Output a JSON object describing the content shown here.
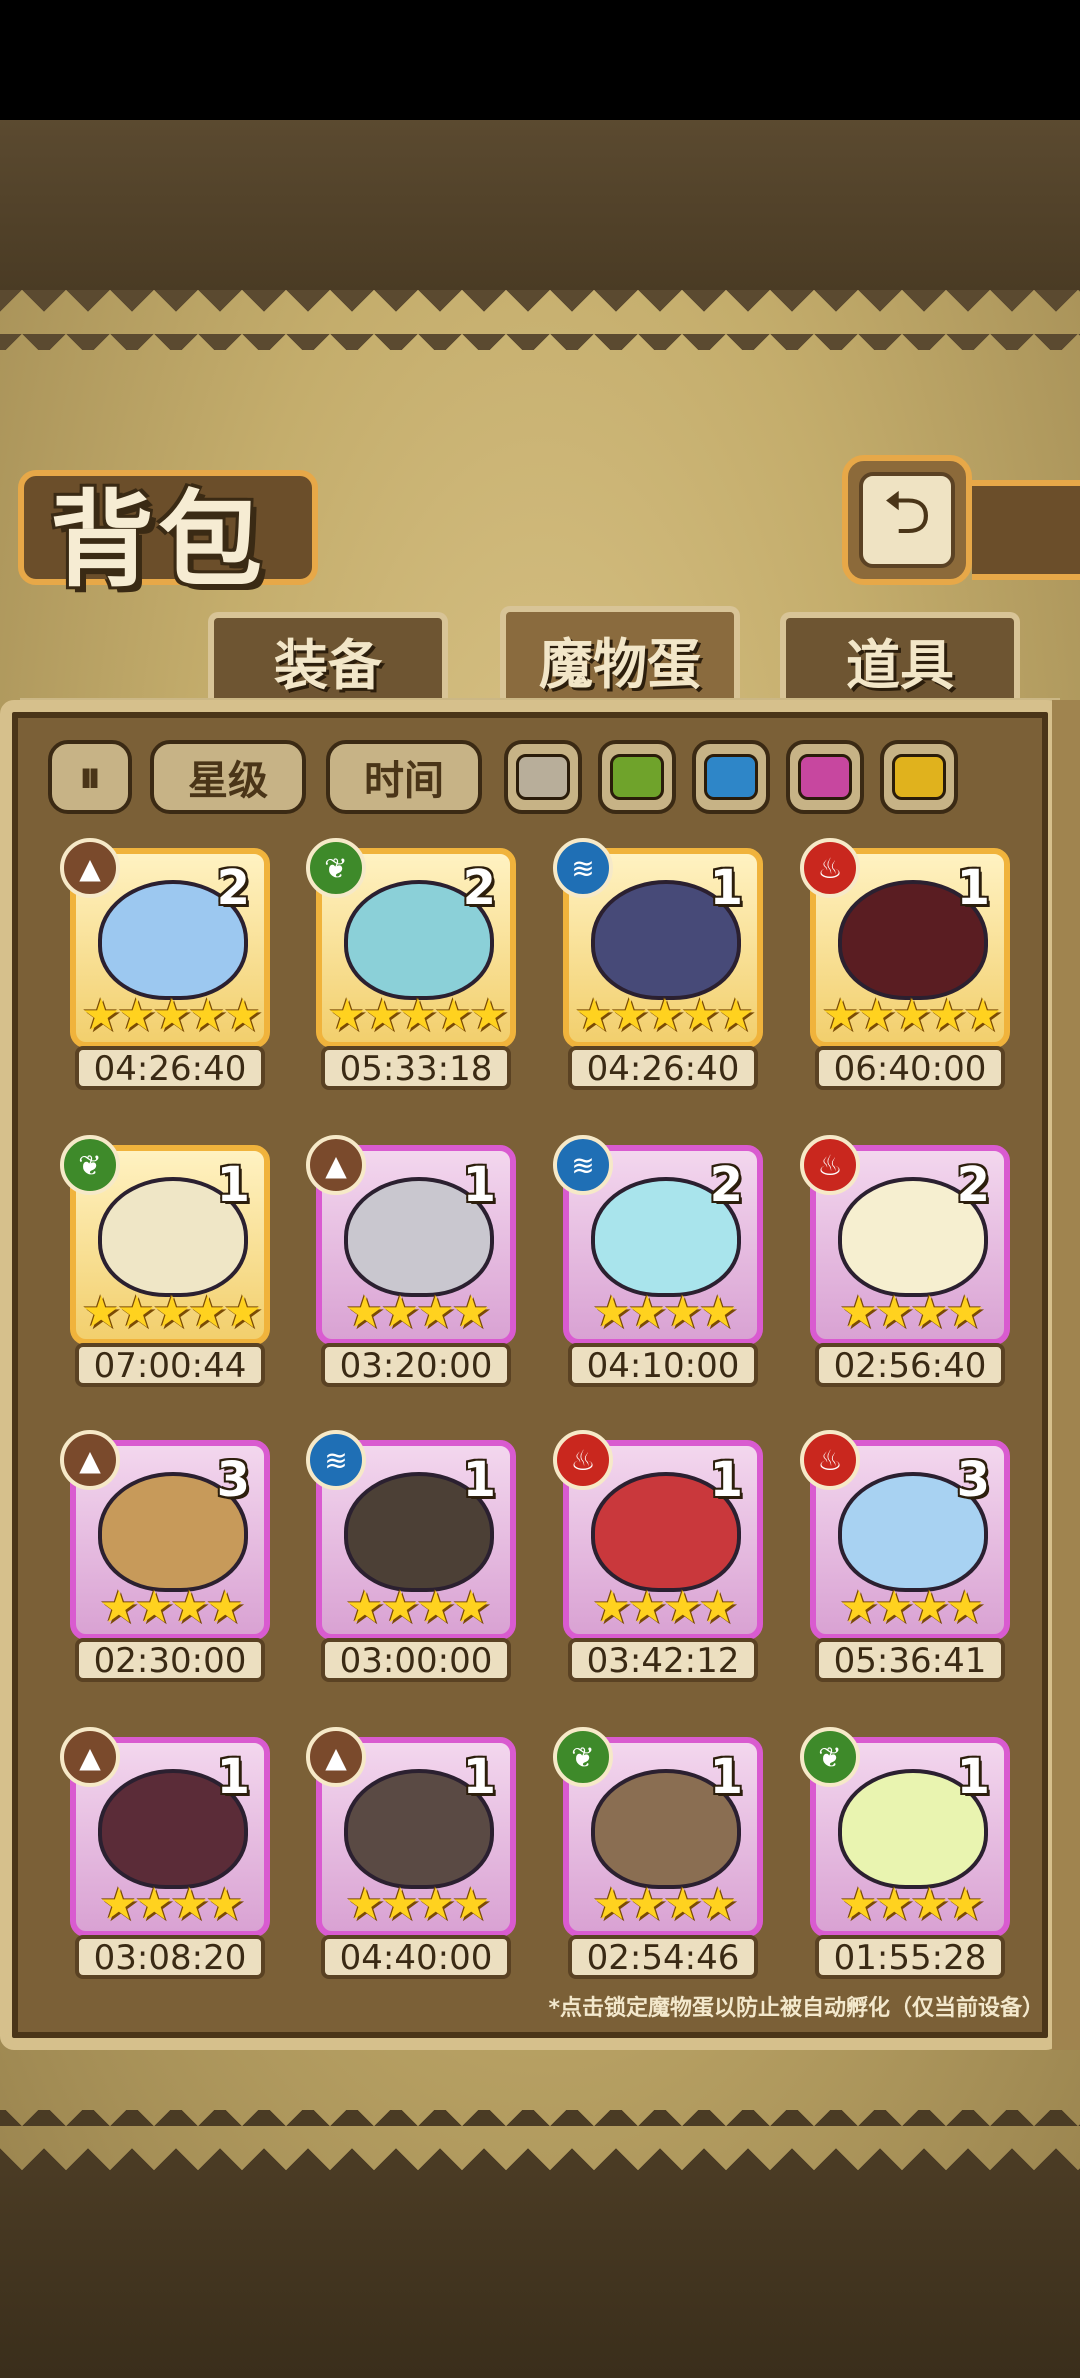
{
  "title": "背包",
  "tabs": [
    {
      "label": "装备",
      "active": false
    },
    {
      "label": "魔物蛋",
      "active": true
    },
    {
      "label": "道具",
      "active": false
    }
  ],
  "filters": {
    "sort_icon": "sort-toggle-icon",
    "star_label": "星级",
    "time_label": "时间",
    "colors": [
      "#b8ae9a",
      "#6fa32b",
      "#2e86c8",
      "#c7479f",
      "#e0b21d"
    ]
  },
  "elements": {
    "earth": "#7a4a2c",
    "plant": "#3e8a2a",
    "water": "#1f6fb5",
    "fire": "#c9271e"
  },
  "eggs": [
    {
      "element": "earth",
      "count": "2",
      "rarity": "gold",
      "stars": "★★★★★",
      "timer": "04:26:40",
      "color": "#9cc8f0"
    },
    {
      "element": "plant",
      "count": "2",
      "rarity": "gold",
      "stars": "★★★★★",
      "timer": "05:33:18",
      "color": "#8bd0d8"
    },
    {
      "element": "water",
      "count": "1",
      "rarity": "gold",
      "stars": "★★★★★",
      "timer": "04:26:40",
      "color": "#474a78"
    },
    {
      "element": "fire",
      "count": "1",
      "rarity": "gold",
      "stars": "★★★★★",
      "timer": "06:40:00",
      "color": "#5a1d22"
    },
    {
      "element": "plant",
      "count": "1",
      "rarity": "gold",
      "stars": "★★★★★",
      "timer": "07:00:44",
      "color": "#efe6c6"
    },
    {
      "element": "earth",
      "count": "1",
      "rarity": "purple",
      "stars": "★★★★",
      "timer": "03:20:00",
      "color": "#c9c7cf"
    },
    {
      "element": "water",
      "count": "2",
      "rarity": "purple",
      "stars": "★★★★",
      "timer": "04:10:00",
      "color": "#a9e4ec"
    },
    {
      "element": "fire",
      "count": "2",
      "rarity": "purple",
      "stars": "★★★★",
      "timer": "02:56:40",
      "color": "#f6efd0"
    },
    {
      "element": "earth",
      "count": "3",
      "rarity": "purple",
      "stars": "★★★★",
      "timer": "02:30:00",
      "color": "#c79a5a"
    },
    {
      "element": "water",
      "count": "1",
      "rarity": "purple",
      "stars": "★★★★",
      "timer": "03:00:00",
      "color": "#4c4036"
    },
    {
      "element": "fire",
      "count": "1",
      "rarity": "purple",
      "stars": "★★★★",
      "timer": "03:42:12",
      "color": "#c9383c"
    },
    {
      "element": "fire",
      "count": "3",
      "rarity": "purple",
      "stars": "★★★★",
      "timer": "05:36:41",
      "color": "#a8d2f2"
    },
    {
      "element": "earth",
      "count": "1",
      "rarity": "purple",
      "stars": "★★★★",
      "timer": "03:08:20",
      "color": "#5b2c38"
    },
    {
      "element": "earth",
      "count": "1",
      "rarity": "purple",
      "stars": "★★★★",
      "timer": "04:40:00",
      "color": "#5a4a44"
    },
    {
      "element": "plant",
      "count": "1",
      "rarity": "purple",
      "stars": "★★★★",
      "timer": "02:54:46",
      "color": "#8a6e52"
    },
    {
      "element": "plant",
      "count": "1",
      "rarity": "purple",
      "stars": "★★★★",
      "timer": "01:55:28",
      "color": "#e9f4b0"
    }
  ],
  "footnote": "*点击锁定魔物蛋以防止被自动孵化（仅当前设备）"
}
